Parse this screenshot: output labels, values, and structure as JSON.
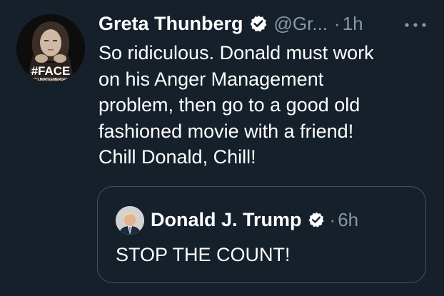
{
  "tweet": {
    "author": {
      "display_name": "Greta Thunberg",
      "handle": "@Gr...",
      "verified": true,
      "avatar_text": "#FACE",
      "avatar_subtext": "THECLIMATEEMERGENCY"
    },
    "separator": "·",
    "time": "1h",
    "more_icon": "more-horizontal-icon",
    "text": "So ridiculous. Donald must work\non his Anger Management\nproblem, then go to a good old\nfashioned movie with a friend!\nChill Donald, Chill!"
  },
  "quote_tweet": {
    "author": {
      "display_name": "Donald J. Trump",
      "verified": true
    },
    "separator": "·",
    "time": "6h",
    "text": "STOP THE COUNT!"
  },
  "colors": {
    "background": "#15202b",
    "text_primary": "#ffffff",
    "text_secondary": "#8899a6",
    "border": "#3d5466",
    "verified_badge": "#ffffff"
  }
}
